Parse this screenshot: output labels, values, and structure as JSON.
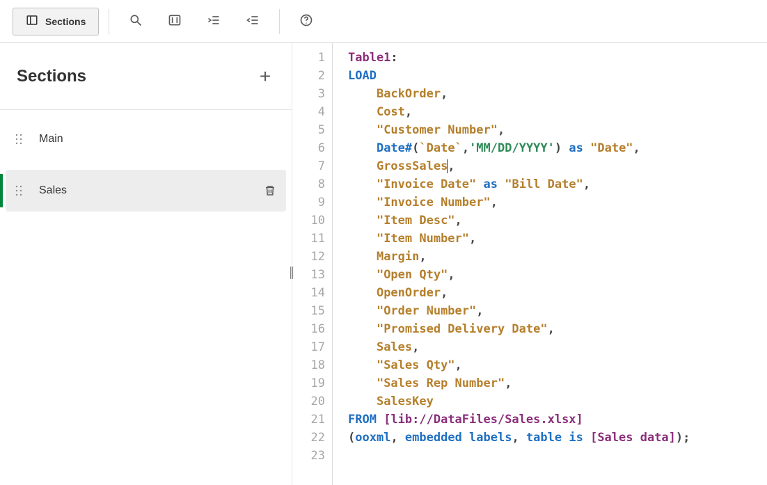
{
  "toolbar": {
    "sections_label": "Sections"
  },
  "sidebar": {
    "title": "Sections",
    "items": [
      {
        "label": "Main",
        "active": false
      },
      {
        "label": "Sales",
        "active": true
      }
    ]
  },
  "editor": {
    "lines": [
      [
        {
          "t": "label",
          "v": "Table1"
        },
        {
          "t": "punct",
          "v": ":"
        }
      ],
      [
        {
          "t": "keyword",
          "v": "LOAD"
        }
      ],
      [
        {
          "t": "indent",
          "v": "    "
        },
        {
          "t": "ident",
          "v": "BackOrder"
        },
        {
          "t": "punct",
          "v": ","
        }
      ],
      [
        {
          "t": "indent",
          "v": "    "
        },
        {
          "t": "ident",
          "v": "Cost"
        },
        {
          "t": "punct",
          "v": ","
        }
      ],
      [
        {
          "t": "indent",
          "v": "    "
        },
        {
          "t": "ident",
          "v": "\"Customer Number\""
        },
        {
          "t": "punct",
          "v": ","
        }
      ],
      [
        {
          "t": "indent",
          "v": "    "
        },
        {
          "t": "func",
          "v": "Date#"
        },
        {
          "t": "punct",
          "v": "("
        },
        {
          "t": "ident",
          "v": "`Date`"
        },
        {
          "t": "punct",
          "v": ","
        },
        {
          "t": "string",
          "v": "'MM/DD/YYYY'"
        },
        {
          "t": "punct",
          "v": ")"
        },
        {
          "t": "space",
          "v": " "
        },
        {
          "t": "keyword",
          "v": "as"
        },
        {
          "t": "space",
          "v": " "
        },
        {
          "t": "ident",
          "v": "\"Date\""
        },
        {
          "t": "punct",
          "v": ","
        }
      ],
      [
        {
          "t": "indent",
          "v": "    "
        },
        {
          "t": "ident",
          "v": "GrossSales"
        },
        {
          "t": "cursor",
          "v": ""
        },
        {
          "t": "punct",
          "v": ","
        }
      ],
      [
        {
          "t": "indent",
          "v": "    "
        },
        {
          "t": "ident",
          "v": "\"Invoice Date\""
        },
        {
          "t": "space",
          "v": " "
        },
        {
          "t": "keyword",
          "v": "as"
        },
        {
          "t": "space",
          "v": " "
        },
        {
          "t": "ident",
          "v": "\"Bill Date\""
        },
        {
          "t": "punct",
          "v": ","
        }
      ],
      [
        {
          "t": "indent",
          "v": "    "
        },
        {
          "t": "ident",
          "v": "\"Invoice Number\""
        },
        {
          "t": "punct",
          "v": ","
        }
      ],
      [
        {
          "t": "indent",
          "v": "    "
        },
        {
          "t": "ident",
          "v": "\"Item Desc\""
        },
        {
          "t": "punct",
          "v": ","
        }
      ],
      [
        {
          "t": "indent",
          "v": "    "
        },
        {
          "t": "ident",
          "v": "\"Item Number\""
        },
        {
          "t": "punct",
          "v": ","
        }
      ],
      [
        {
          "t": "indent",
          "v": "    "
        },
        {
          "t": "ident",
          "v": "Margin"
        },
        {
          "t": "punct",
          "v": ","
        }
      ],
      [
        {
          "t": "indent",
          "v": "    "
        },
        {
          "t": "ident",
          "v": "\"Open Qty\""
        },
        {
          "t": "punct",
          "v": ","
        }
      ],
      [
        {
          "t": "indent",
          "v": "    "
        },
        {
          "t": "ident",
          "v": "OpenOrder"
        },
        {
          "t": "punct",
          "v": ","
        }
      ],
      [
        {
          "t": "indent",
          "v": "    "
        },
        {
          "t": "ident",
          "v": "\"Order Number\""
        },
        {
          "t": "punct",
          "v": ","
        }
      ],
      [
        {
          "t": "indent",
          "v": "    "
        },
        {
          "t": "ident",
          "v": "\"Promised Delivery Date\""
        },
        {
          "t": "punct",
          "v": ","
        }
      ],
      [
        {
          "t": "indent",
          "v": "    "
        },
        {
          "t": "ident",
          "v": "Sales"
        },
        {
          "t": "punct",
          "v": ","
        }
      ],
      [
        {
          "t": "indent",
          "v": "    "
        },
        {
          "t": "ident",
          "v": "\"Sales Qty\""
        },
        {
          "t": "punct",
          "v": ","
        }
      ],
      [
        {
          "t": "indent",
          "v": "    "
        },
        {
          "t": "ident",
          "v": "\"Sales Rep Number\""
        },
        {
          "t": "punct",
          "v": ","
        }
      ],
      [
        {
          "t": "indent",
          "v": "    "
        },
        {
          "t": "ident",
          "v": "SalesKey"
        }
      ],
      [
        {
          "t": "keyword",
          "v": "FROM"
        },
        {
          "t": "space",
          "v": " "
        },
        {
          "t": "bracket",
          "v": "[lib://DataFiles/Sales.xlsx]"
        }
      ],
      [
        {
          "t": "punct",
          "v": "("
        },
        {
          "t": "keyword",
          "v": "ooxml"
        },
        {
          "t": "punct",
          "v": ", "
        },
        {
          "t": "keyword",
          "v": "embedded labels"
        },
        {
          "t": "punct",
          "v": ", "
        },
        {
          "t": "keyword",
          "v": "table is"
        },
        {
          "t": "space",
          "v": " "
        },
        {
          "t": "bracket",
          "v": "[Sales data]"
        },
        {
          "t": "punct",
          "v": ");"
        }
      ],
      []
    ]
  }
}
